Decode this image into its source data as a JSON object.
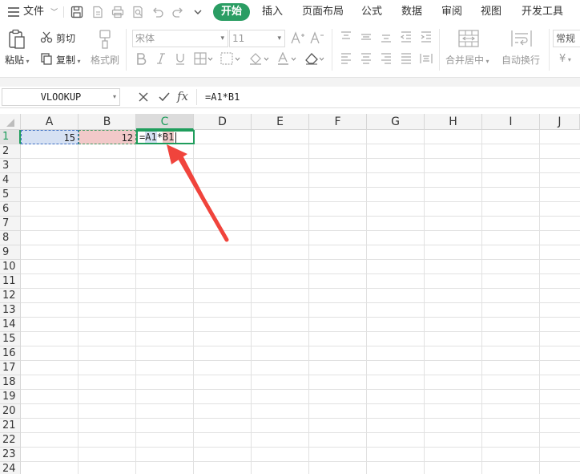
{
  "menubar": {
    "hamburger_icon": "menu-icon",
    "file_label": "文件",
    "tabs": [
      {
        "label": "开始",
        "active": true
      },
      {
        "label": "插入"
      },
      {
        "label": "页面布局"
      },
      {
        "label": "公式"
      },
      {
        "label": "数据"
      },
      {
        "label": "审阅"
      },
      {
        "label": "视图"
      },
      {
        "label": "开发工具"
      }
    ],
    "active_tab_color": "#2a9d63"
  },
  "ribbon": {
    "paste_label": "粘贴",
    "cut_label": "剪切",
    "copy_label": "复制",
    "format_painter_label": "格式刷",
    "font_name_placeholder": "宋体",
    "font_size_placeholder": "11",
    "merge_center_label": "合并居中",
    "wrap_text_label": "自动换行",
    "number_format_label": "常规",
    "currency_symbol": "¥"
  },
  "formula_bar": {
    "name_box": "VLOOKUP",
    "fx_label": "fx",
    "formula": "=A1*B1"
  },
  "sheet": {
    "columns": [
      "A",
      "B",
      "C",
      "D",
      "E",
      "F",
      "G",
      "H",
      "I",
      "J"
    ],
    "rows": [
      "1",
      "2",
      "3",
      "4",
      "5",
      "6",
      "7",
      "8",
      "9",
      "10",
      "11",
      "12",
      "13",
      "14",
      "15",
      "16",
      "17",
      "18",
      "19",
      "20",
      "21",
      "22",
      "23",
      "24"
    ],
    "active_column": "C",
    "active_row": "1",
    "cells": {
      "A1": "15",
      "B1": "12",
      "C1": {
        "eq": "=",
        "ref_a": "A1",
        "op": "*",
        "ref_b": "B1"
      }
    },
    "ref_colors": {
      "A1": "#d6e1f3",
      "B1": "#f2c9c9"
    },
    "annotation_arrow_color": "#f0443c"
  }
}
